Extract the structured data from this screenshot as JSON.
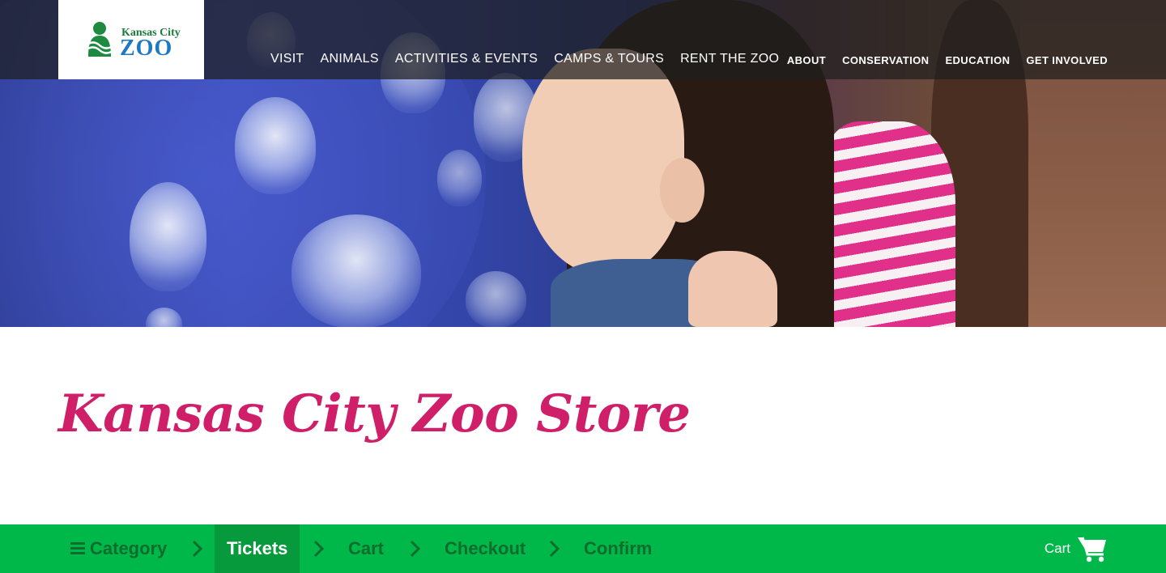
{
  "header": {
    "logo": {
      "line1": "Kansas City",
      "line2": "ZOO"
    },
    "main_nav": [
      "VISIT",
      "ANIMALS",
      "ACTIVITIES & EVENTS",
      "CAMPS & TOURS",
      "RENT THE ZOO"
    ],
    "util_nav": [
      "ABOUT",
      "CONSERVATION",
      "EDUCATION",
      "GET INVOLVED"
    ]
  },
  "page": {
    "title": "Kansas City Zoo Store"
  },
  "steps": {
    "items": [
      "Category",
      "Tickets",
      "Cart",
      "Checkout",
      "Confirm"
    ],
    "active": "Tickets",
    "cart_label": "Cart"
  },
  "colors": {
    "title": "#cf1f68",
    "steps_bar": "#00b84a",
    "steps_active": "#079a3c",
    "steps_text": "#0d6d2c"
  },
  "icons": [
    "menu-icon",
    "chevron-right-icon",
    "shopping-cart-icon",
    "zoo-logo-icon"
  ]
}
